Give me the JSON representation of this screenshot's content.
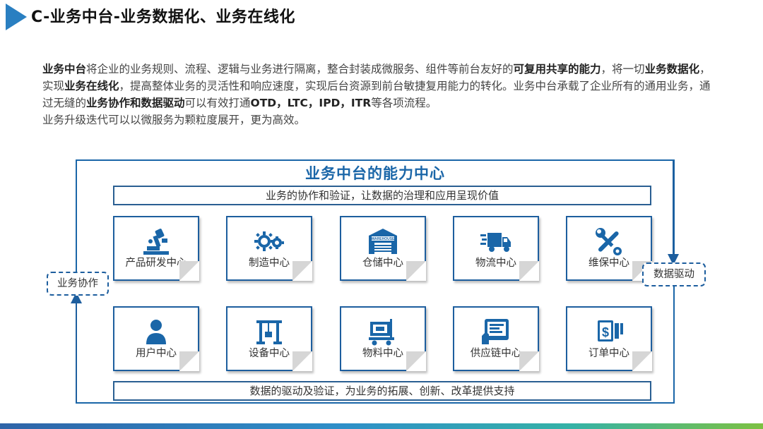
{
  "title": "C-业务中台-业务数据化、业务在线化",
  "intro": {
    "p1": [
      {
        "t": "业务中台",
        "b": true
      },
      {
        "t": "将企业的业务规则、流程、逻辑与业务进行隔离，整合封装成微服务、组件等前台友好的",
        "b": false
      },
      {
        "t": "可复用共享的能力",
        "b": true
      },
      {
        "t": "，将一切",
        "b": false
      },
      {
        "t": "业务数据化",
        "b": true
      },
      {
        "t": "，实现",
        "b": false
      },
      {
        "t": "业务在线化",
        "b": true
      },
      {
        "t": "，提高整体业务的灵活性和响应速度，实现后台资源到前台敏捷复用能力的转化。业务中台承载了企业所有的通用业务，通过无缝的",
        "b": false
      },
      {
        "t": "业务协作和数据驱动",
        "b": true
      },
      {
        "t": "可以有效打通",
        "b": false
      },
      {
        "t": "OTD，LTC，IPD，ITR",
        "b": true
      },
      {
        "t": "等各项流程。",
        "b": false
      }
    ],
    "p2": "业务升级迭代可以以微服务为颗粒度展开，更为高效。"
  },
  "diagram": {
    "title": "业务中台的能力中心",
    "top_banner": "业务的协作和验证，让数据的治理和应用呈现价值",
    "bottom_banner": "数据的驱动及验证，为业务的拓展、创新、改革提供支持",
    "left_label": "业务协作",
    "right_label": "数据驱动",
    "row1": [
      {
        "label": "产品研发中心",
        "icon": "microscope-icon"
      },
      {
        "label": "制造中心",
        "icon": "gears-icon"
      },
      {
        "label": "仓储中心",
        "icon": "warehouse-icon"
      },
      {
        "label": "物流中心",
        "icon": "truck-icon"
      },
      {
        "label": "维保中心",
        "icon": "wrench-screwdriver-icon"
      }
    ],
    "row2": [
      {
        "label": "用户中心",
        "icon": "user-icon"
      },
      {
        "label": "设备中心",
        "icon": "crane-icon"
      },
      {
        "label": "物料中心",
        "icon": "cart-icon"
      },
      {
        "label": "供应链中心",
        "icon": "tablet-icon"
      },
      {
        "label": "订单中心",
        "icon": "dollar-doc-icon"
      }
    ],
    "warehouse_sign": "WAREHOUSE",
    "accent_color": "#1a66a8"
  }
}
